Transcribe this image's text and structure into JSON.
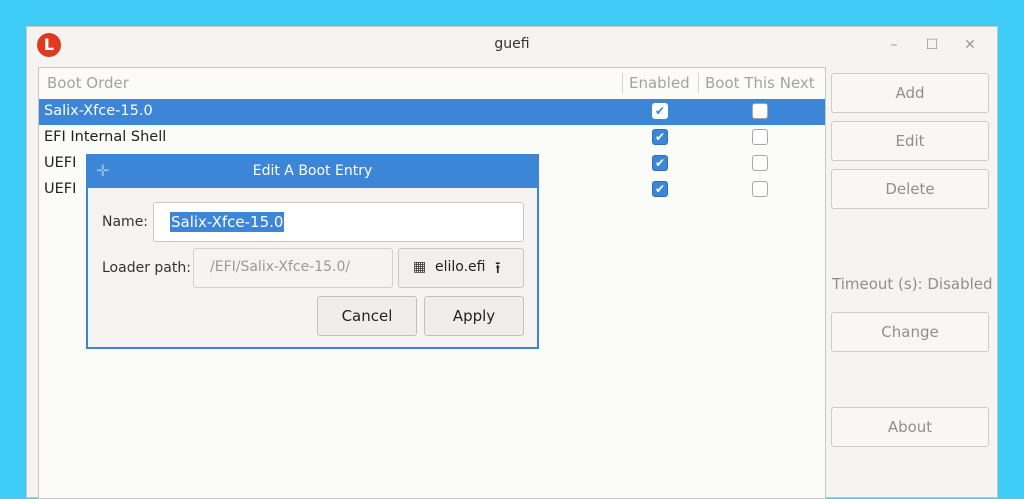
{
  "window": {
    "title": "guefi",
    "logo_letter": "L"
  },
  "title_controls": {
    "minimize": "–",
    "maximize": "☐",
    "close": "✕"
  },
  "list": {
    "headers": {
      "boot_order": "Boot Order",
      "enabled": "Enabled",
      "boot_next": "Boot This Next"
    },
    "rows": [
      {
        "label": "Salix-Xfce-15.0",
        "enabled": true,
        "boot_next": false,
        "selected": true
      },
      {
        "label": "EFI Internal Shell",
        "enabled": true,
        "boot_next": false
      },
      {
        "label": "UEFI",
        "enabled": true,
        "boot_next": false
      },
      {
        "label": "UEFI",
        "enabled": true,
        "boot_next": false
      }
    ]
  },
  "sidebar": {
    "add": "Add",
    "edit": "Edit",
    "delete": "Delete",
    "timeout": "Timeout (s): Disabled",
    "change": "Change",
    "about": "About"
  },
  "dialog": {
    "title": "Edit A Boot Entry",
    "name_label": "Name:",
    "name_value": "Salix-Xfce-15.0",
    "loader_label": "Loader path:",
    "loader_value": "/EFI/Salix-Xfce-15.0/",
    "file_button": "elilo.efi",
    "cancel": "Cancel",
    "apply": "Apply"
  },
  "icons": {
    "check": "✔",
    "pin": "✛",
    "file": "▦",
    "upload": "⭱"
  },
  "colors": {
    "accent": "#3d85d6",
    "desktop": "#3fcdf7",
    "logo": "#e03a1e"
  }
}
